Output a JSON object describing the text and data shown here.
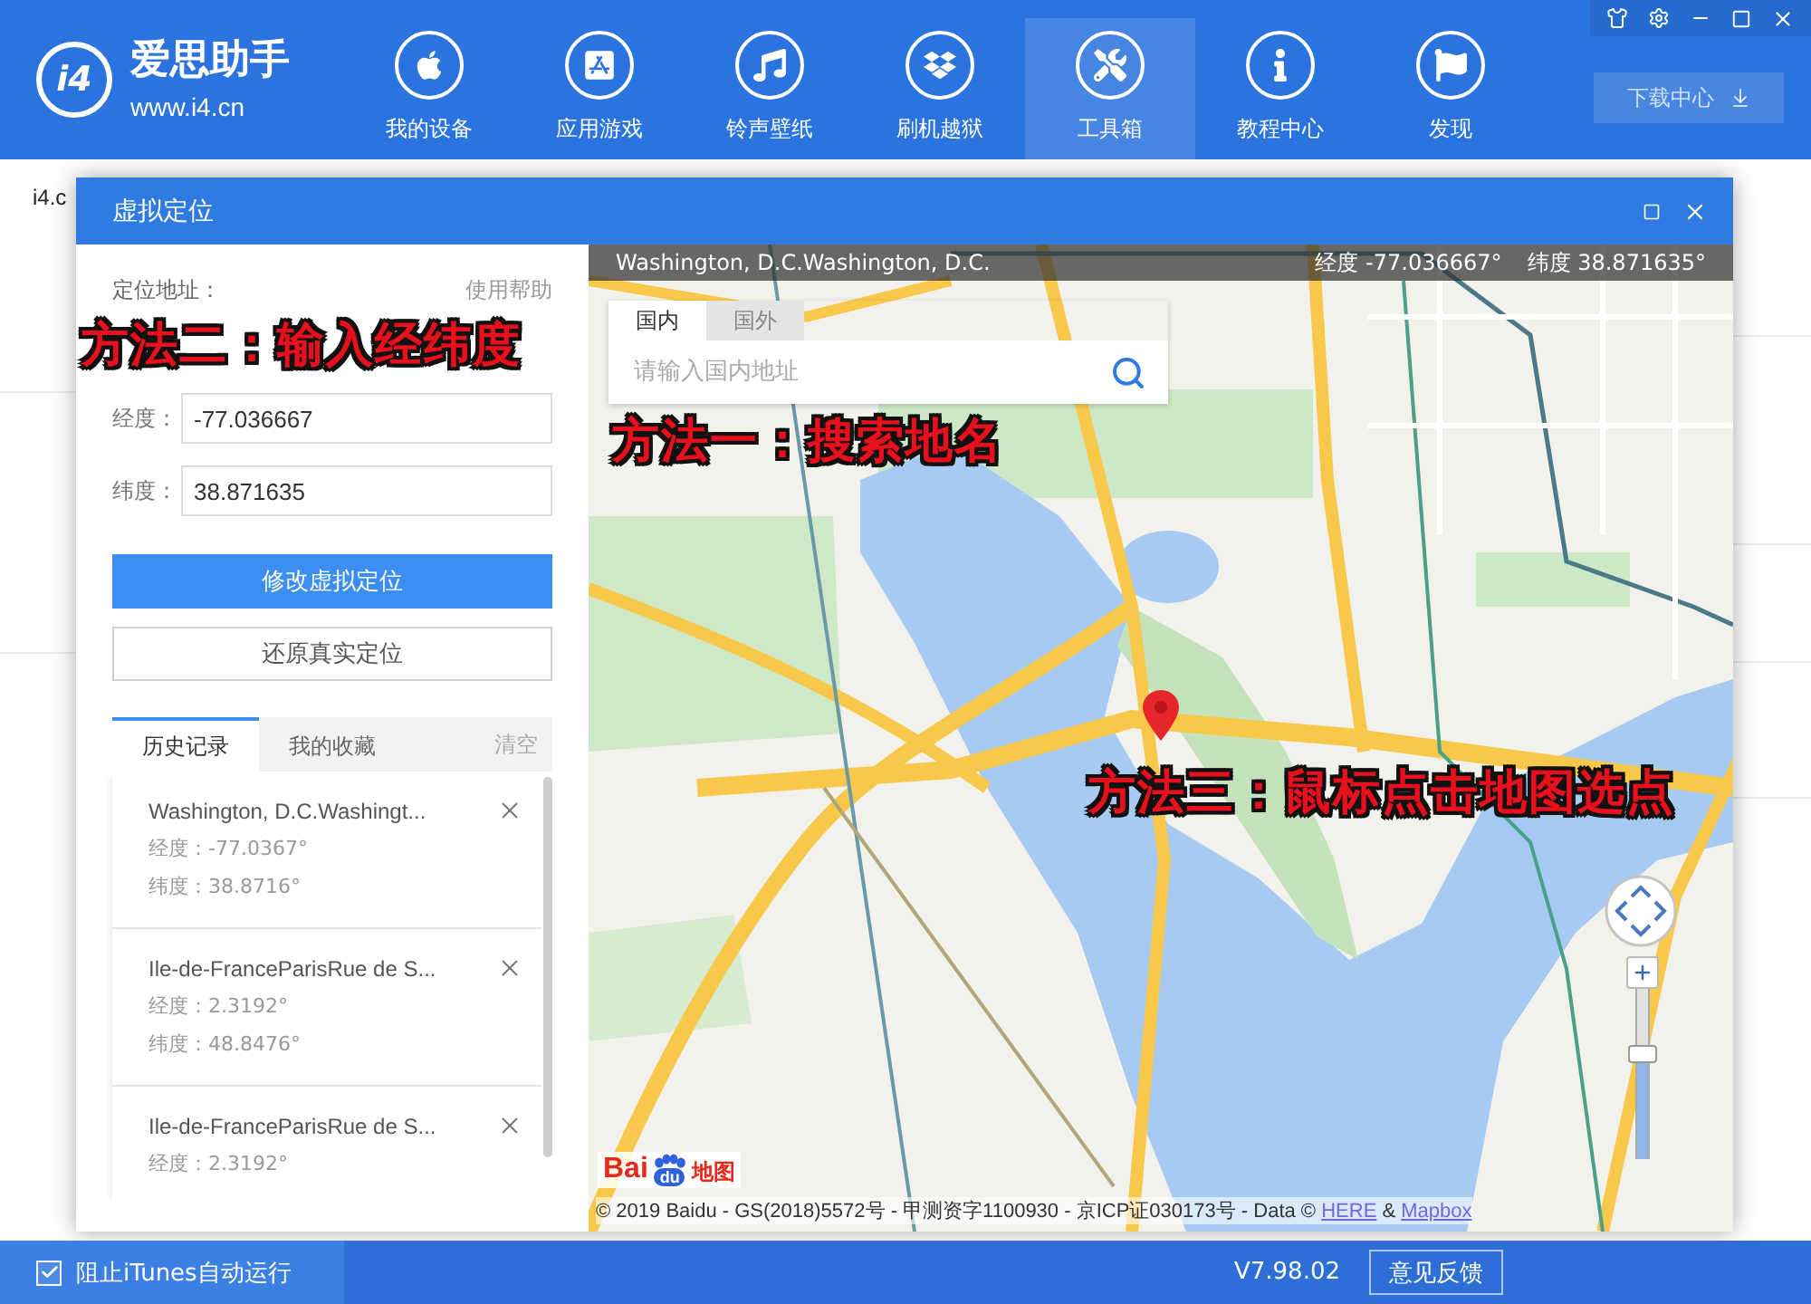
{
  "app": {
    "logo_mark": "i4",
    "name": "爱思助手",
    "url": "www.i4.cn"
  },
  "nav": [
    {
      "label": "我的设备",
      "selected": false
    },
    {
      "label": "应用游戏",
      "selected": false
    },
    {
      "label": "铃声壁纸",
      "selected": false
    },
    {
      "label": "刷机越狱",
      "selected": false
    },
    {
      "label": "工具箱",
      "selected": true
    },
    {
      "label": "教程中心",
      "selected": false
    },
    {
      "label": "发现",
      "selected": false
    }
  ],
  "download_button": {
    "label": "下载中心"
  },
  "background": {
    "tab_text": "i4.c"
  },
  "dialog": {
    "title": "虚拟定位"
  },
  "location_panel": {
    "address_label": "定位地址：",
    "help_link": "使用帮助",
    "annotation": "方法二：输入经纬度",
    "fields": [
      {
        "label": "经度：",
        "value": "-77.036667"
      },
      {
        "label": "纬度：",
        "value": "38.871635"
      }
    ],
    "buttons": [
      {
        "label": "修改虚拟定位",
        "kind": "primary"
      },
      {
        "label": "还原真实定位",
        "kind": "secondary"
      }
    ],
    "tabs": [
      {
        "label": "历史记录",
        "selected": true
      },
      {
        "label": "我的收藏",
        "selected": false
      }
    ],
    "clear_link": "清空",
    "history": [
      {
        "title": "Washington, D.C.Washingt...",
        "longitude": "经度：-77.0367°",
        "latitude": "纬度：38.8716°"
      },
      {
        "title": "Ile-de-FranceParisRue de S...",
        "longitude": "经度：2.3192°",
        "latitude": "纬度：48.8476°"
      },
      {
        "title": "Ile-de-FranceParisRue de S...",
        "longitude": "经度：2.3192°"
      }
    ]
  },
  "map": {
    "place": "Washington, D.C.Washington, D.C.",
    "longitude": "经度 -77.036667°",
    "latitude": "纬度 38.871635°",
    "search": {
      "tabs": [
        {
          "label": "国内",
          "selected": true
        },
        {
          "label": "国外",
          "selected": false
        }
      ],
      "placeholder": "请输入国内地址"
    },
    "annotations": [
      "方法一：搜索地名",
      "方法三：鼠标点击地图选点"
    ],
    "zoom": {
      "level": 0.63
    },
    "logo": {
      "prefix": "Bai",
      "mark": "du",
      "suffix": "地图"
    },
    "copyright": {
      "text": "© 2019 Baidu - GS(2018)5572号 - 甲测资字1100930 - 京ICP证030173号 - Data © ",
      "links": [
        "HERE",
        "Mapbox"
      ],
      "joiner": " & "
    }
  },
  "status_bar": {
    "itunes_block": {
      "label": "阻止iTunes自动运行",
      "checked": true
    },
    "version": "V7.98.02",
    "feedback_button": "意见反馈"
  }
}
